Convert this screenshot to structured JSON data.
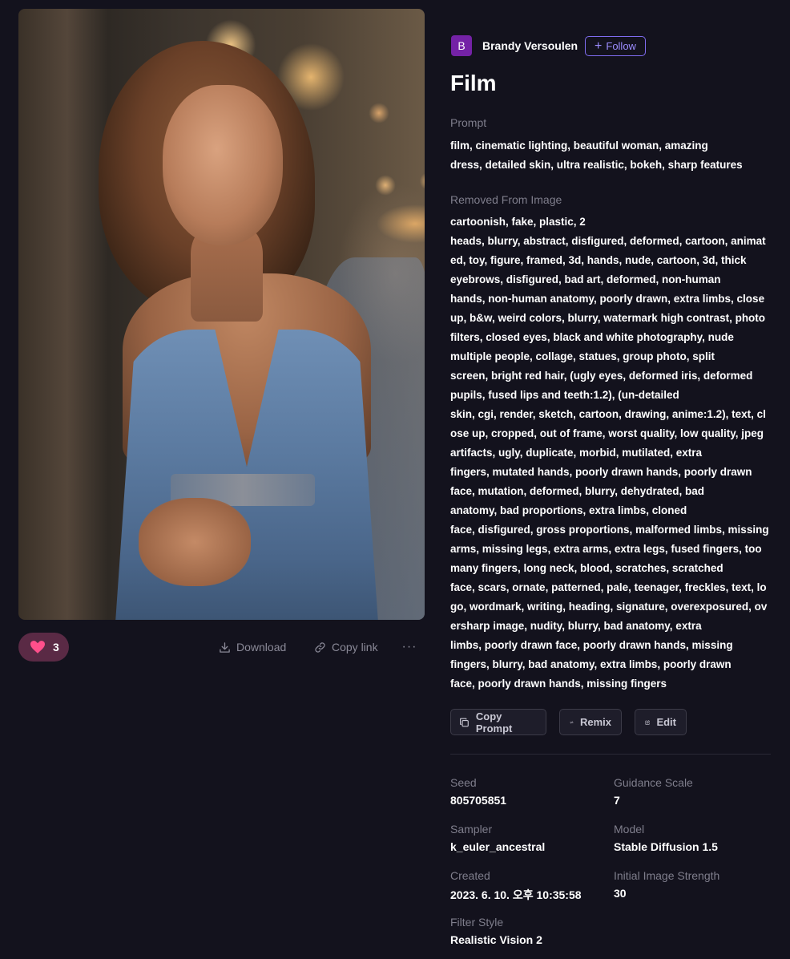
{
  "image": {
    "alt": ""
  },
  "actions": {
    "like_count": "3",
    "download_label": "Download",
    "copy_link_label": "Copy link",
    "more_label": "···"
  },
  "author": {
    "initial": "B",
    "name": "Brandy Versoulen",
    "follow_label": "Follow"
  },
  "title": "Film",
  "prompt": {
    "label": "Prompt",
    "text": "film, cinematic lighting, beautiful woman, amazing\ndress, detailed skin, ultra realistic, bokeh, sharp features"
  },
  "removed": {
    "label": "Removed From Image",
    "text": "cartoonish, fake, plastic, 2\nheads, blurry, abstract, disfigured, deformed, cartoon, animat\ned, toy, figure, framed, 3d, hands, nude, cartoon, 3d, thick\neyebrows, disfigured, bad art, deformed, non-human\nhands, non-human anatomy, poorly drawn, extra limbs, close\nup, b&w, weird colors, blurry, watermark high contrast, photo\nfilters, closed eyes, black and white photography, nude\nmultiple people, collage, statues, group photo, split\nscreen, bright red hair, (ugly eyes, deformed iris, deformed\npupils, fused lips and teeth:1.2), (un-detailed\nskin, cgi, render, sketch, cartoon, drawing, anime:1.2), text, cl\nose up, cropped, out of frame, worst quality, low quality, jpeg\nartifacts, ugly, duplicate, morbid, mutilated, extra\nfingers, mutated hands, poorly drawn hands, poorly drawn\nface, mutation, deformed, blurry, dehydrated, bad\nanatomy, bad proportions, extra limbs, cloned\nface, disfigured, gross proportions, malformed limbs, missing\narms, missing legs, extra arms, extra legs, fused fingers, too\nmany fingers, long neck, blood, scratches, scratched\nface, scars, ornate, patterned, pale, teenager, freckles, text, lo\ngo, wordmark, writing, heading, signature, overexposured, ov\nersharp image, nudity, blurry, bad anatomy, extra\nlimbs, poorly drawn face, poorly drawn hands, missing\nfingers, blurry, bad anatomy, extra limbs, poorly drawn\nface, poorly drawn hands, missing fingers"
  },
  "buttons": {
    "copy_prompt": "Copy Prompt",
    "remix": "Remix",
    "edit": "Edit"
  },
  "meta": {
    "seed_label": "Seed",
    "seed_value": "805705851",
    "guidance_label": "Guidance Scale",
    "guidance_value": "7",
    "sampler_label": "Sampler",
    "sampler_value": "k_euler_ancestral",
    "model_label": "Model",
    "model_value": "Stable Diffusion 1.5",
    "created_label": "Created",
    "created_value": "2023. 6. 10. 오후 10:35:58",
    "strength_label": "Initial Image Strength",
    "strength_value": "30",
    "filter_label": "Filter Style",
    "filter_value": "Realistic Vision 2"
  },
  "colors": {
    "background": "#13121d",
    "accent": "#7f6cf0",
    "like_bg": "#5a2a45",
    "heart": "#ff4f8b",
    "avatar": "#7422a6"
  }
}
